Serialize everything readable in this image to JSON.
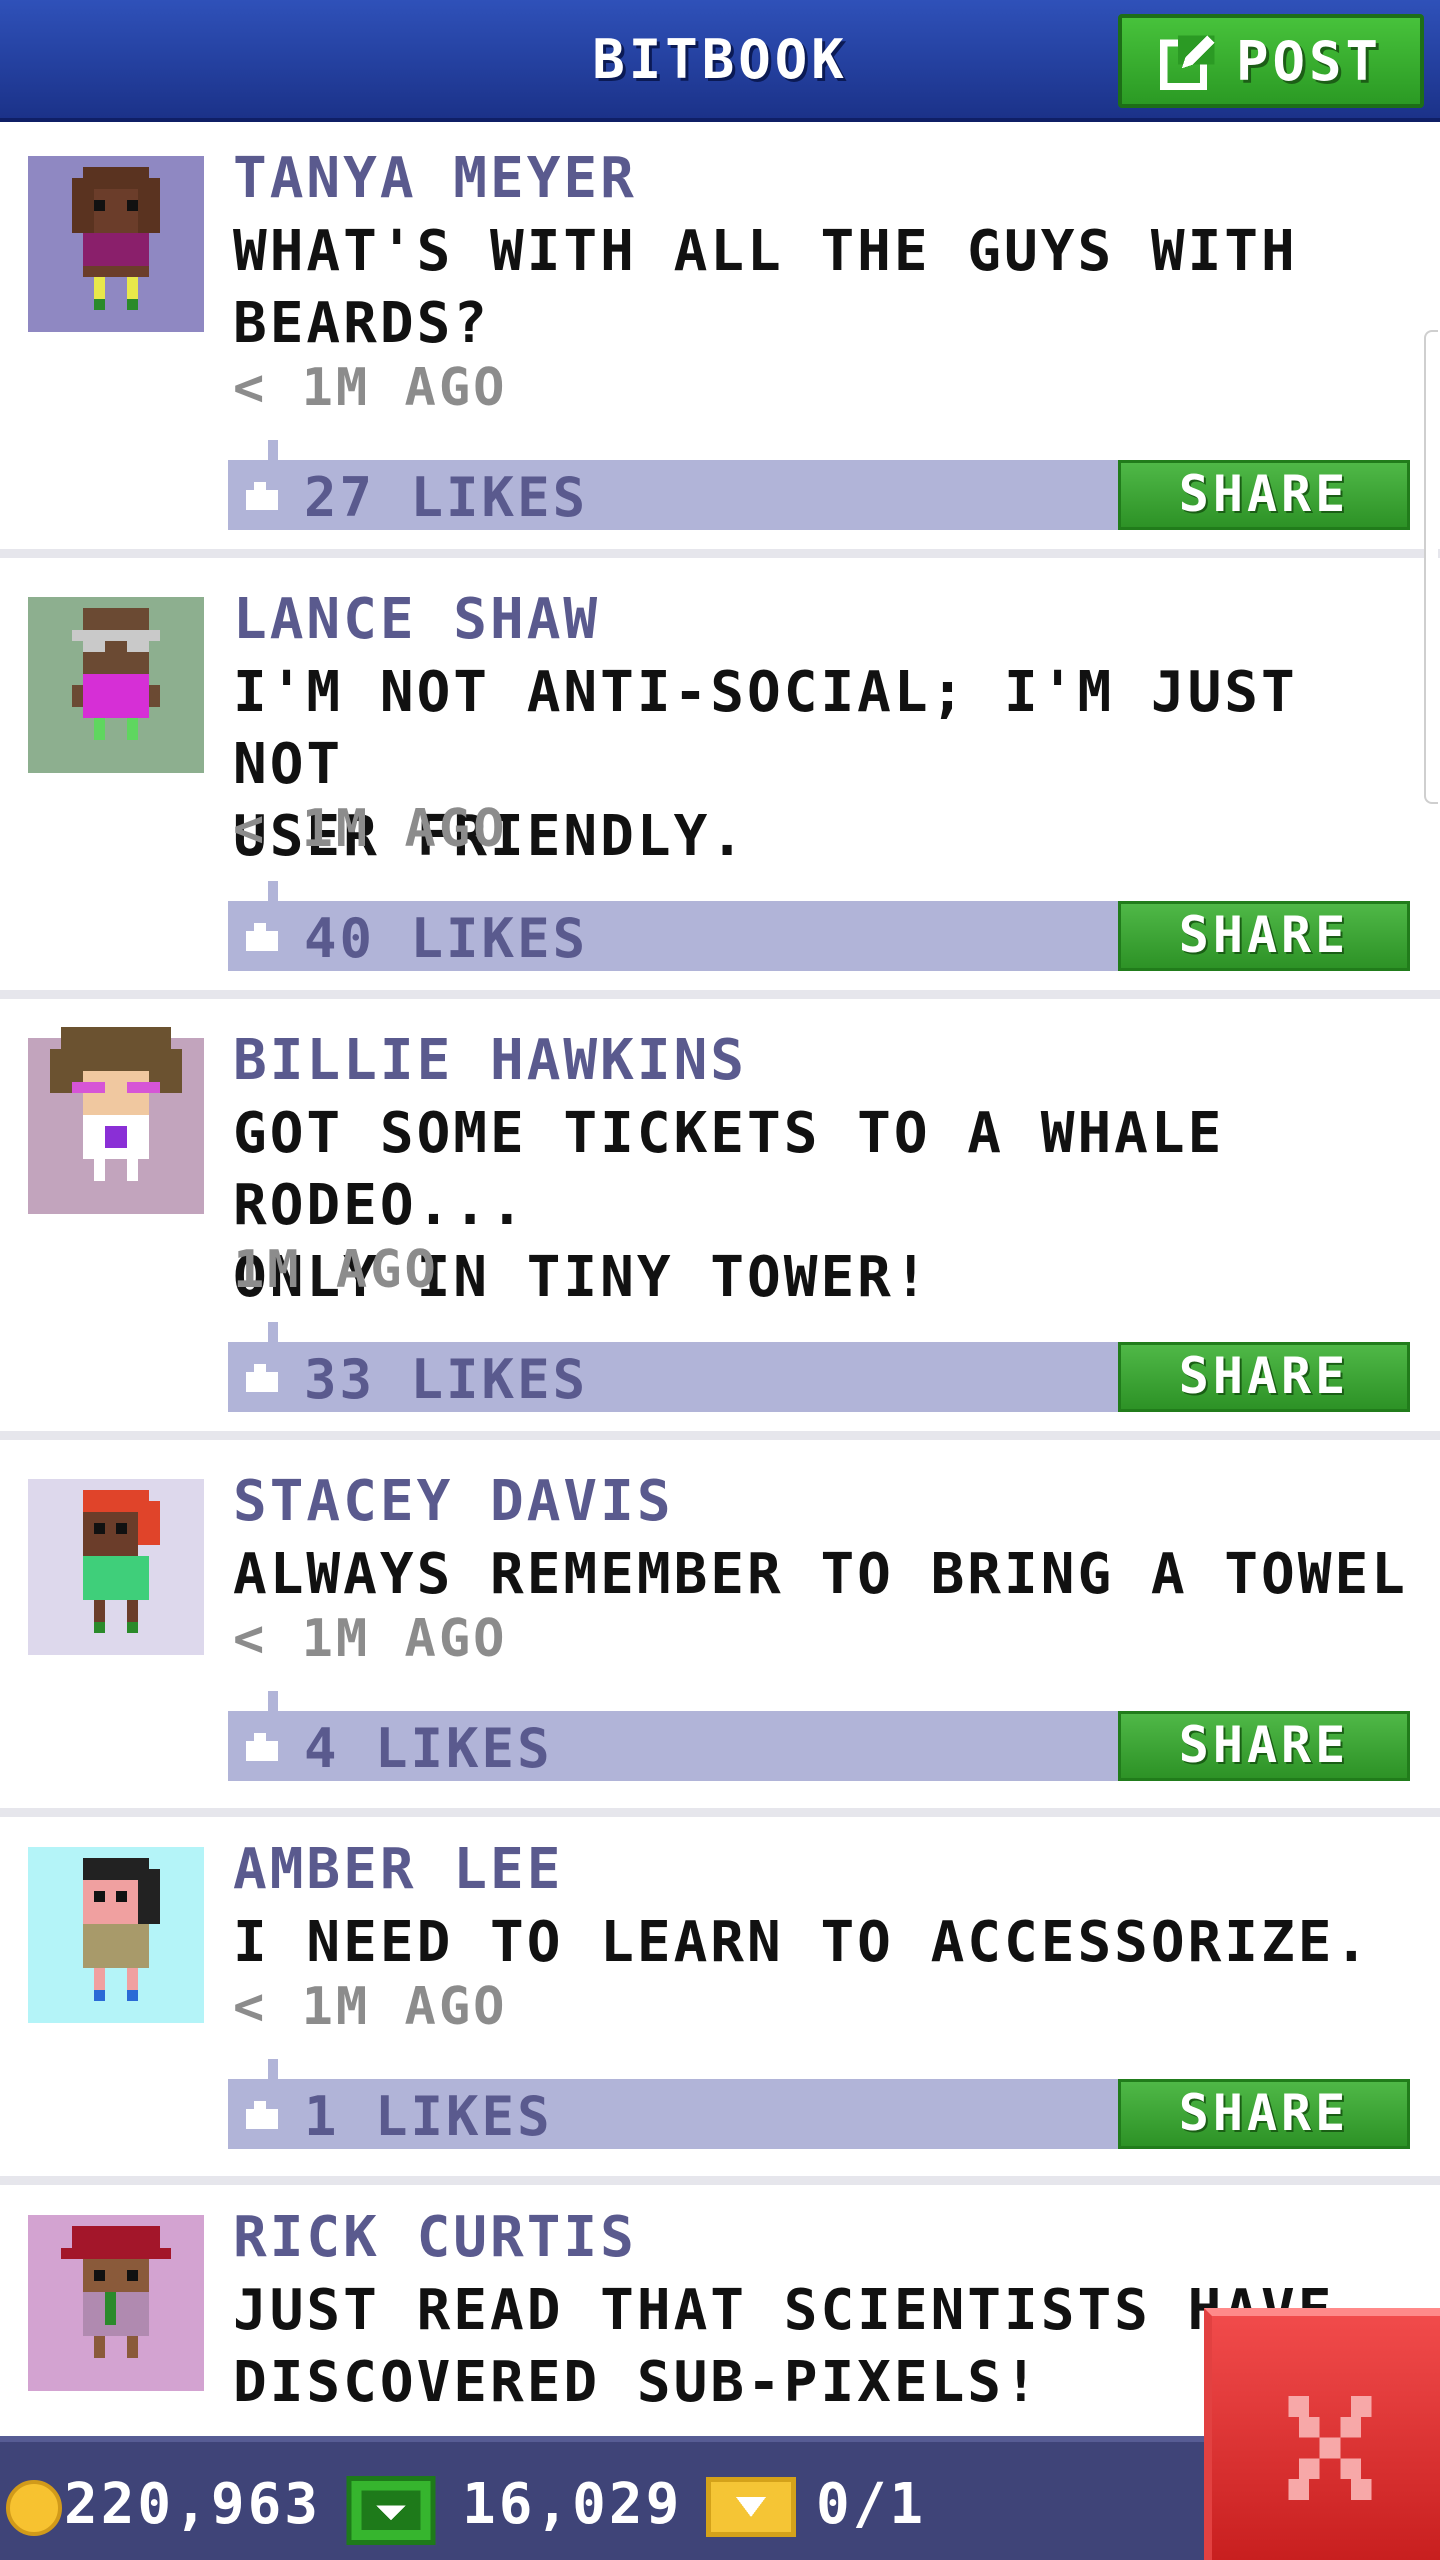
{
  "header": {
    "title": "BITBOOK",
    "post_label": "POST"
  },
  "posts": [
    {
      "author": "TANYA MEYER",
      "message": "WHAT'S WITH ALL THE GUYS WITH\nBEARDS?",
      "time": "< 1M AGO",
      "likes": "27 LIKES",
      "share_label": "SHARE",
      "avatar_bg": "#8f88c2"
    },
    {
      "author": "LANCE SHAW",
      "message": "I'M NOT ANTI-SOCIAL; I'M JUST NOT\nUSER FRIENDLY.",
      "time": "< 1M AGO",
      "likes": "40 LIKES",
      "share_label": "SHARE",
      "avatar_bg": "#8daf8f"
    },
    {
      "author": "BILLIE HAWKINS",
      "message": "GOT SOME TICKETS TO A WHALE RODEO...\nONLY IN TINY TOWER!",
      "time": "1M AGO",
      "likes": "33 LIKES",
      "share_label": "SHARE",
      "avatar_bg": "#c2a4bd"
    },
    {
      "author": "STACEY DAVIS",
      "message": "ALWAYS REMEMBER TO BRING A TOWEL",
      "time": "< 1M AGO",
      "likes": "4 LIKES",
      "share_label": "SHARE",
      "avatar_bg": "#ddd8ec"
    },
    {
      "author": "AMBER LEE",
      "message": "I NEED TO LEARN TO ACCESSORIZE.",
      "time": "< 1M AGO",
      "likes": "1 LIKES",
      "share_label": "SHARE",
      "avatar_bg": "#b4f4f8"
    },
    {
      "author": "RICK CURTIS",
      "message": "JUST READ THAT SCIENTISTS HAVE\nDISCOVERED SUB-PIXELS!",
      "time": "",
      "likes": "",
      "share_label": "",
      "avatar_bg": "#d3a3d1"
    }
  ],
  "bottom_bar": {
    "coins": "220,963",
    "bux": "16,029",
    "tickets": "0/1"
  },
  "colors": {
    "header": "#2f51b9",
    "accent_green": "#3aa830",
    "likes_bar": "#b1b4d8",
    "author_text": "#5a5a8e",
    "close_red": "#e03434"
  },
  "icons": {
    "post": "edit-icon",
    "like": "thumbs-up-icon",
    "coin": "coin-icon",
    "bux": "bux-icon",
    "ticket": "ticket-icon",
    "close": "close-icon"
  }
}
